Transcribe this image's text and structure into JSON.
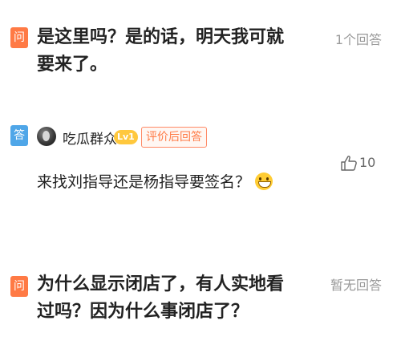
{
  "questions": [
    {
      "question_tag": "问",
      "question_text": "是这里吗？是的话，明天我可就要来了。",
      "answer_count": "1个回答",
      "answer": {
        "answer_tag": "答",
        "username": "吃瓜群众",
        "level": "Lv1",
        "review_badge": "评价后回答",
        "text": "来找刘指导还是杨指导要签名？",
        "emoji_icon": "grinning-face-emoji-icon",
        "like_count": "10",
        "like_icon": "thumbs-up-icon"
      }
    },
    {
      "question_tag": "问",
      "question_text": "为什么显示闭店了，有人实地看过吗？因为什么事闭店了？",
      "answer_count": "暂无回答"
    }
  ],
  "colors": {
    "question_tag": "#ff7a45",
    "answer_tag": "#4fa6e8",
    "level_badge": "#ffc83d",
    "review_badge_border": "#ff8a66",
    "meta_text": "#999999"
  }
}
